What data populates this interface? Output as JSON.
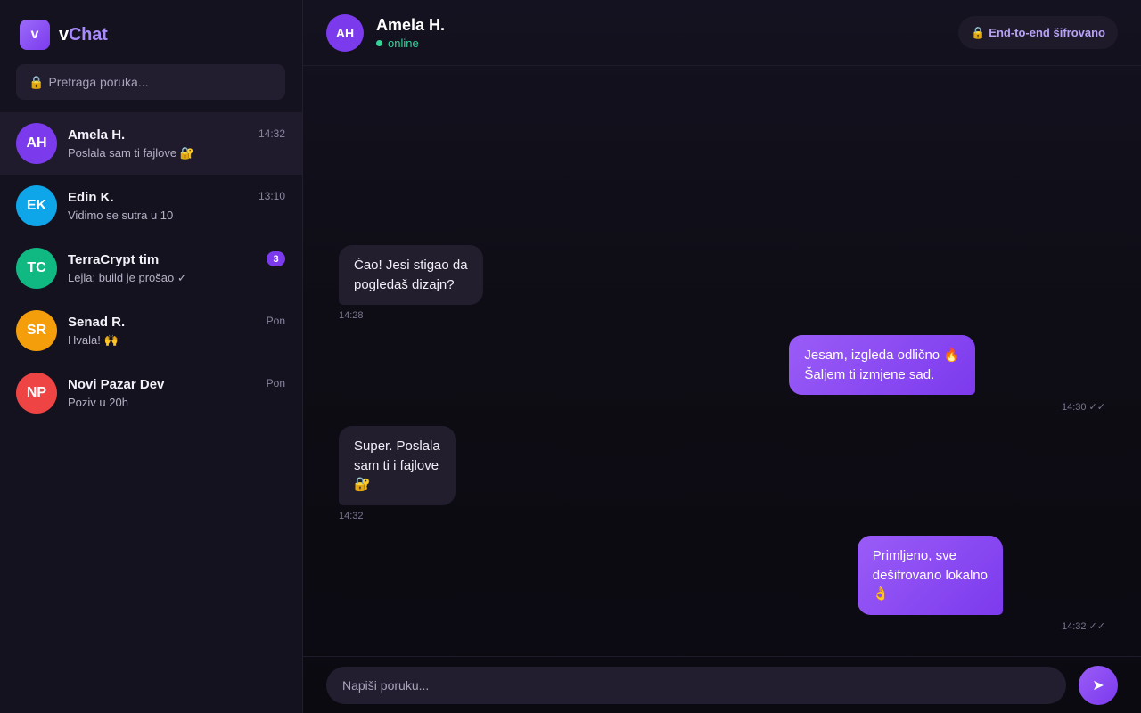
{
  "app": {
    "logo_letter": "v",
    "name_first": "v",
    "name_rest": "Chat"
  },
  "search": {
    "placeholder": "Pretraga poruka...",
    "icon": "lock-icon"
  },
  "conversations": [
    {
      "initials": "AH",
      "name": "Amela H.",
      "preview": "Poslala sam ti fajlove 🔐",
      "time": "14:32",
      "color": "#7c3aed",
      "active": true
    },
    {
      "initials": "EK",
      "name": "Edin K.",
      "preview": "Vidimo se sutra u 10",
      "time": "13:10",
      "color": "#0ea5e9"
    },
    {
      "initials": "TC",
      "name": "TerraCrypt tim",
      "preview": "Lejla: build je prošao ✓",
      "badge": "3",
      "color": "#10b981"
    },
    {
      "initials": "SR",
      "name": "Senad R.",
      "preview": "Hvala! 🙌",
      "time": "Pon",
      "color": "#f59e0b"
    },
    {
      "initials": "NP",
      "name": "Novi Pazar Dev",
      "preview": "Poziv u 20h",
      "time": "Pon",
      "color": "#ef4444"
    }
  ],
  "chat": {
    "contact_initials": "AH",
    "contact_name": "Amela H.",
    "status": "online",
    "status_color": "#34d399",
    "encryption_label": "End-to-end šifrovano",
    "encryption_icon": "lock-icon"
  },
  "messages": [
    {
      "direction": "in",
      "lines": [
        "Ćao! Jesi stigao da",
        "pogledaš dizajn?"
      ],
      "time": "14:28"
    },
    {
      "direction": "out",
      "lines": [
        "Jesam, izgleda odlično 🔥",
        "Šaljem ti izmjene sad."
      ],
      "time": "14:30 ✓✓"
    },
    {
      "direction": "in",
      "lines": [
        "Super. Poslala",
        "sam ti i fajlove",
        "🔐"
      ],
      "time": "14:32"
    },
    {
      "direction": "out",
      "lines": [
        "Primljeno, sve",
        "dešifrovano lokalno",
        "👌"
      ],
      "time": "14:32 ✓✓"
    }
  ],
  "composer": {
    "placeholder": "Napiši poruku...",
    "send_icon": "send-icon"
  },
  "colors": {
    "accent": "#7c3aed",
    "accent_light": "#a78bfa",
    "background": "#0f0d16",
    "sidebar": "#15121f"
  }
}
